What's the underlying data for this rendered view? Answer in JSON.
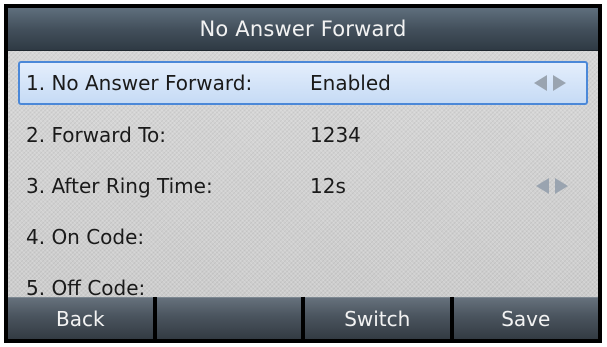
{
  "title": "No Answer Forward",
  "rows": [
    {
      "label": "1. No Answer Forward:",
      "value": "Enabled",
      "has_arrows": true,
      "selected": true
    },
    {
      "label": "2. Forward To:",
      "value": "1234",
      "has_arrows": false,
      "selected": false
    },
    {
      "label": "3. After Ring Time:",
      "value": "12s",
      "has_arrows": true,
      "selected": false
    },
    {
      "label": "4. On Code:",
      "value": "",
      "has_arrows": false,
      "selected": false
    },
    {
      "label": "5. Off Code:",
      "value": "",
      "has_arrows": false,
      "selected": false
    }
  ],
  "softkeys": [
    "Back",
    "",
    "Switch",
    "Save"
  ],
  "colors": {
    "selection_border": "#4b88d8",
    "arrow": "#9aa4b0",
    "title_text": "#f2f2f2"
  },
  "icons": {
    "left_arrow": "left-arrow-icon",
    "right_arrow": "right-arrow-icon"
  }
}
